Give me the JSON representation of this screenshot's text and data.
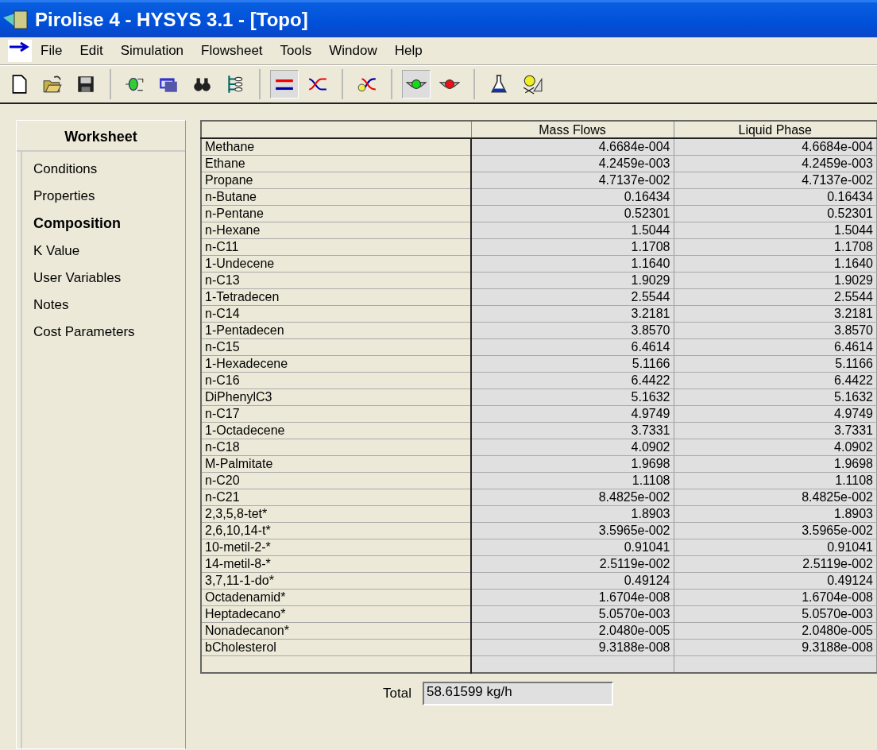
{
  "window": {
    "title": "Pirolise 4 - HYSYS 3.1 - [Topo]"
  },
  "menu": [
    "File",
    "Edit",
    "Simulation",
    "Flowsheet",
    "Tools",
    "Window",
    "Help"
  ],
  "toolbar": [
    [
      {
        "pressed": false
      },
      {
        "pressed": false
      },
      {
        "pressed": false
      }
    ],
    [
      {
        "pressed": false
      },
      {
        "pressed": false
      },
      {
        "pressed": false
      },
      {
        "pressed": false
      }
    ],
    [
      {
        "pressed": true
      },
      {
        "pressed": false
      }
    ],
    [
      {
        "pressed": false
      }
    ],
    [
      {
        "pressed": true
      },
      {
        "pressed": false
      }
    ],
    [
      {
        "pressed": false
      },
      {
        "pressed": false
      }
    ]
  ],
  "sidebar": {
    "title": "Worksheet",
    "items": [
      {
        "label": "Conditions",
        "selected": false
      },
      {
        "label": "Properties",
        "selected": false
      },
      {
        "label": "Composition",
        "selected": true
      },
      {
        "label": "K Value",
        "selected": false
      },
      {
        "label": "User Variables",
        "selected": false
      },
      {
        "label": "Notes",
        "selected": false
      },
      {
        "label": "Cost Parameters",
        "selected": false
      }
    ]
  },
  "table": {
    "columns": [
      "",
      "Mass Flows",
      "Liquid Phase"
    ],
    "rows": [
      [
        "Methane",
        "4.6684e-004",
        "4.6684e-004"
      ],
      [
        "Ethane",
        "4.2459e-003",
        "4.2459e-003"
      ],
      [
        "Propane",
        "4.7137e-002",
        "4.7137e-002"
      ],
      [
        "n-Butane",
        "0.16434",
        "0.16434"
      ],
      [
        "n-Pentane",
        "0.52301",
        "0.52301"
      ],
      [
        "n-Hexane",
        "1.5044",
        "1.5044"
      ],
      [
        "n-C11",
        "1.1708",
        "1.1708"
      ],
      [
        "1-Undecene",
        "1.1640",
        "1.1640"
      ],
      [
        "n-C13",
        "1.9029",
        "1.9029"
      ],
      [
        "1-Tetradecen",
        "2.5544",
        "2.5544"
      ],
      [
        "n-C14",
        "3.2181",
        "3.2181"
      ],
      [
        "1-Pentadecen",
        "3.8570",
        "3.8570"
      ],
      [
        "n-C15",
        "6.4614",
        "6.4614"
      ],
      [
        "1-Hexadecene",
        "5.1166",
        "5.1166"
      ],
      [
        "n-C16",
        "6.4422",
        "6.4422"
      ],
      [
        "DiPhenylC3",
        "5.1632",
        "5.1632"
      ],
      [
        "n-C17",
        "4.9749",
        "4.9749"
      ],
      [
        "1-Octadecene",
        "3.7331",
        "3.7331"
      ],
      [
        "n-C18",
        "4.0902",
        "4.0902"
      ],
      [
        "M-Palmitate",
        "1.9698",
        "1.9698"
      ],
      [
        "n-C20",
        "1.1108",
        "1.1108"
      ],
      [
        "n-C21",
        "8.4825e-002",
        "8.4825e-002"
      ],
      [
        "2,3,5,8-tet*",
        "1.8903",
        "1.8903"
      ],
      [
        "2,6,10,14-t*",
        "3.5965e-002",
        "3.5965e-002"
      ],
      [
        "10-metil-2-*",
        "0.91041",
        "0.91041"
      ],
      [
        "14-metil-8-*",
        "2.5119e-002",
        "2.5119e-002"
      ],
      [
        "3,7,11-1-do*",
        "0.49124",
        "0.49124"
      ],
      [
        "Octadenamid*",
        "1.6704e-008",
        "1.6704e-008"
      ],
      [
        "Heptadecano*",
        "5.0570e-003",
        "5.0570e-003"
      ],
      [
        "Nonadecanon*",
        "2.0480e-005",
        "2.0480e-005"
      ],
      [
        "bCholesterol",
        "9.3188e-008",
        "9.3188e-008"
      ]
    ]
  },
  "total": {
    "label": "Total",
    "value": "58.61599 kg/h"
  }
}
